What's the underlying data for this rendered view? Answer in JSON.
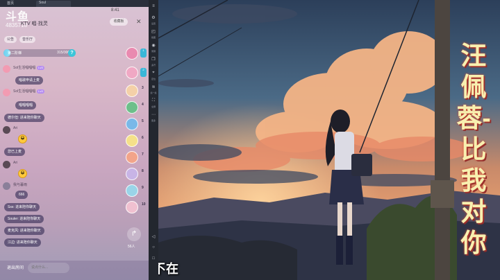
{
  "phone": {
    "tab_home": "首页",
    "tab_active": "Soul",
    "status_time": "8:41",
    "watermark_logo": "斗鱼",
    "watermark_id": "4835718",
    "room_title": "KTV 唱·找灵",
    "fav_label": "收藏板",
    "chips": [
      "公告",
      "音乐厅"
    ],
    "progress": {
      "label": "第二阶梯",
      "value": "315/3000",
      "fraction": 0.1
    },
    "messages": [
      {
        "user": "Sol生活唱唱唱",
        "tag": "Lv3",
        "bubble": "唱歌申请上麦"
      },
      {
        "user": "Sol生活唱唱唱",
        "tag": "Lv3",
        "bubble": "唱唱唱唱"
      },
      {
        "bubble": "德尔但: 进来陪你聊天"
      },
      {
        "user": "Ari",
        "emoji": "😀"
      },
      {
        "bubble": "您已上麦"
      },
      {
        "user": "Ari",
        "emoji": "😀"
      },
      {
        "user": "我与暮雨",
        "bubble": "666"
      },
      {
        "bubble": "Sss: 进来陪你聊天"
      },
      {
        "bubble": "Souler: 进来陪你聊天"
      },
      {
        "bubble": "麦克风: 进来陪你聊天"
      },
      {
        "bubble": "江边: 进来陪你聊天"
      }
    ],
    "seats": [
      "1",
      "2",
      "3",
      "4",
      "5",
      "6",
      "7",
      "8",
      "9",
      "10"
    ],
    "share_count": "56人",
    "exit_label": "退出房间",
    "say_placeholder": "说点什么..."
  },
  "toolbar": {
    "items": [
      "设置",
      "截图",
      "录屏",
      "多开",
      "定位",
      "摇一摇",
      "全屏",
      "更多"
    ]
  },
  "video": {
    "lyric": "爱 从今而后你不在",
    "side_title": "汪佩蓉-比我对你"
  },
  "colors": {
    "accent": "#3cc6d9",
    "bubble": "#3c325a",
    "lyric": "#ffffff",
    "side_title": "#f8f0b0"
  }
}
